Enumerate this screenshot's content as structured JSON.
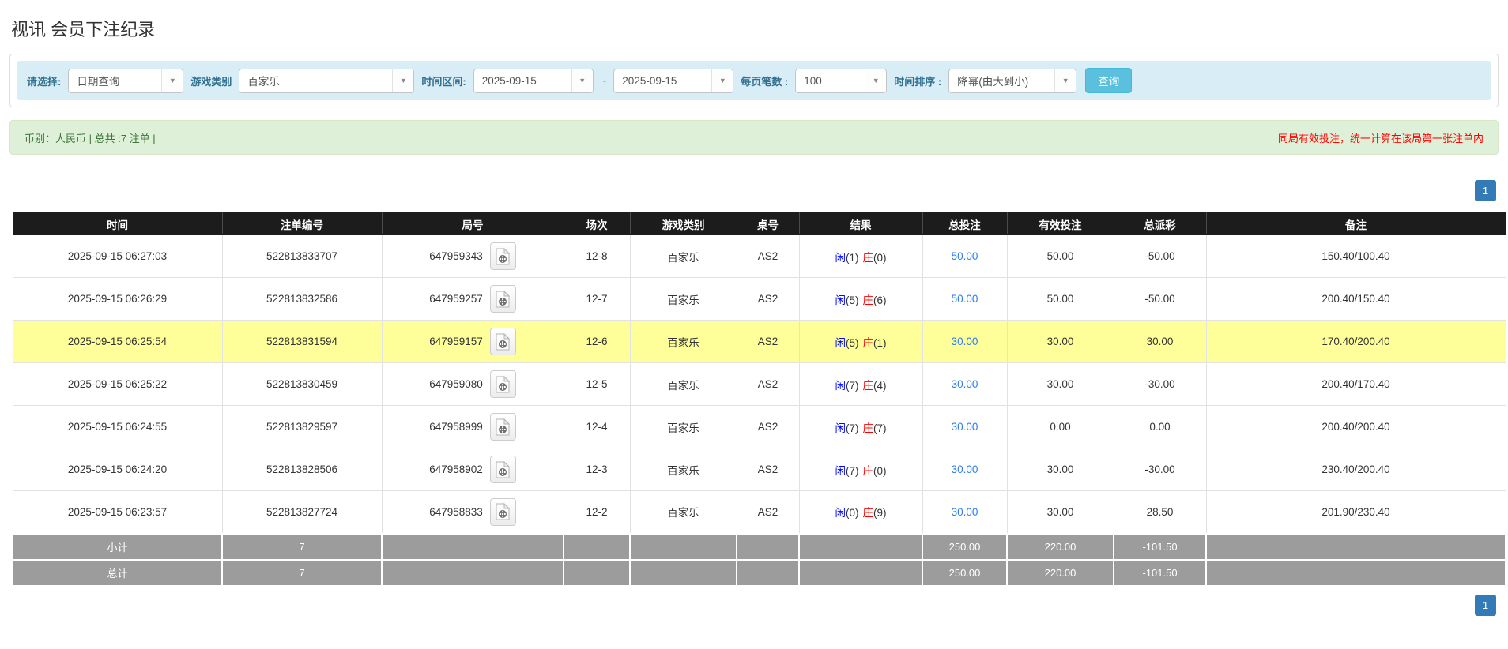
{
  "page": {
    "title": "视讯 会员下注纪录"
  },
  "filter": {
    "select_label": "请选择:",
    "select_value": "日期查询",
    "game_label": "游戏类别",
    "game_value": "百家乐",
    "range_label": "时间区间:",
    "date_from": "2025-09-15",
    "tilde": "~",
    "date_to": "2025-09-15",
    "page_size_label": "每页笔数 :",
    "page_size_value": "100",
    "sort_label": "时间排序 :",
    "sort_value": "降幂(由大到小)",
    "search_button": "查询"
  },
  "summary_bar": {
    "left": "币别：人民币 | 总共 :7 注单 |",
    "right_note": "同局有效投注，统一计算在该局第一张注单内"
  },
  "pagination": {
    "page": "1"
  },
  "colors": {
    "accent_blue": "#2b7cf0",
    "negative_red": "#ff0000",
    "player_blue": "#0008ff",
    "banker_red": "#ff0000",
    "highlight_yellow": "#ffff99",
    "header_black": "#1c1c1c",
    "summary_gray": "#9c9c9c",
    "filter_bar_blue": "#d9edf7",
    "summary_bar_green": "#dff0d8",
    "pager_blue": "#337ab7",
    "search_btn_blue": "#5bc0de"
  },
  "table": {
    "headers": [
      "时间",
      "注单编号",
      "局号",
      "场次",
      "游戏类别",
      "桌号",
      "结果",
      "总投注",
      "有效投注",
      "总派彩",
      "备注"
    ],
    "rows": [
      {
        "time": "2025-09-15 06:27:03",
        "bet_id": "522813833707",
        "round": "647959343",
        "session": "12-8",
        "game": "百家乐",
        "table_no": "AS2",
        "xian": "闲",
        "xian_n": "(1)",
        "zhuang": "庄",
        "zhuang_n": "(0)",
        "total": "50.00",
        "valid": "50.00",
        "payout": "-50.00",
        "remark": "150.40/100.40"
      },
      {
        "time": "2025-09-15 06:26:29",
        "bet_id": "522813832586",
        "round": "647959257",
        "session": "12-7",
        "game": "百家乐",
        "table_no": "AS2",
        "xian": "闲",
        "xian_n": "(5)",
        "zhuang": "庄",
        "zhuang_n": "(6)",
        "total": "50.00",
        "valid": "50.00",
        "payout": "-50.00",
        "remark": "200.40/150.40"
      },
      {
        "time": "2025-09-15 06:25:54",
        "bet_id": "522813831594",
        "round": "647959157",
        "session": "12-6",
        "game": "百家乐",
        "table_no": "AS2",
        "xian": "闲",
        "xian_n": "(5)",
        "zhuang": "庄",
        "zhuang_n": "(1)",
        "total": "30.00",
        "valid": "30.00",
        "payout": "30.00",
        "remark": "170.40/200.40"
      },
      {
        "time": "2025-09-15 06:25:22",
        "bet_id": "522813830459",
        "round": "647959080",
        "session": "12-5",
        "game": "百家乐",
        "table_no": "AS2",
        "xian": "闲",
        "xian_n": "(7)",
        "zhuang": "庄",
        "zhuang_n": "(4)",
        "total": "30.00",
        "valid": "30.00",
        "payout": "-30.00",
        "remark": "200.40/170.40"
      },
      {
        "time": "2025-09-15 06:24:55",
        "bet_id": "522813829597",
        "round": "647958999",
        "session": "12-4",
        "game": "百家乐",
        "table_no": "AS2",
        "xian": "闲",
        "xian_n": "(7)",
        "zhuang": "庄",
        "zhuang_n": "(7)",
        "total": "30.00",
        "valid": "0.00",
        "payout": "0.00",
        "remark": "200.40/200.40"
      },
      {
        "time": "2025-09-15 06:24:20",
        "bet_id": "522813828506",
        "round": "647958902",
        "session": "12-3",
        "game": "百家乐",
        "table_no": "AS2",
        "xian": "闲",
        "xian_n": "(7)",
        "zhuang": "庄",
        "zhuang_n": "(0)",
        "total": "30.00",
        "valid": "30.00",
        "payout": "-30.00",
        "remark": "230.40/200.40"
      },
      {
        "time": "2025-09-15 06:23:57",
        "bet_id": "522813827724",
        "round": "647958833",
        "session": "12-2",
        "game": "百家乐",
        "table_no": "AS2",
        "xian": "闲",
        "xian_n": "(0)",
        "zhuang": "庄",
        "zhuang_n": "(9)",
        "total": "30.00",
        "valid": "30.00",
        "payout": "28.50",
        "remark": "201.90/230.40"
      }
    ],
    "highlighted_row_index": 2,
    "subtotal": {
      "label": "小计",
      "count": "7",
      "total": "250.00",
      "valid": "220.00",
      "payout": "-101.50"
    },
    "grand_total": {
      "label": "总计",
      "count": "7",
      "total": "250.00",
      "valid": "220.00",
      "payout": "-101.50"
    }
  }
}
